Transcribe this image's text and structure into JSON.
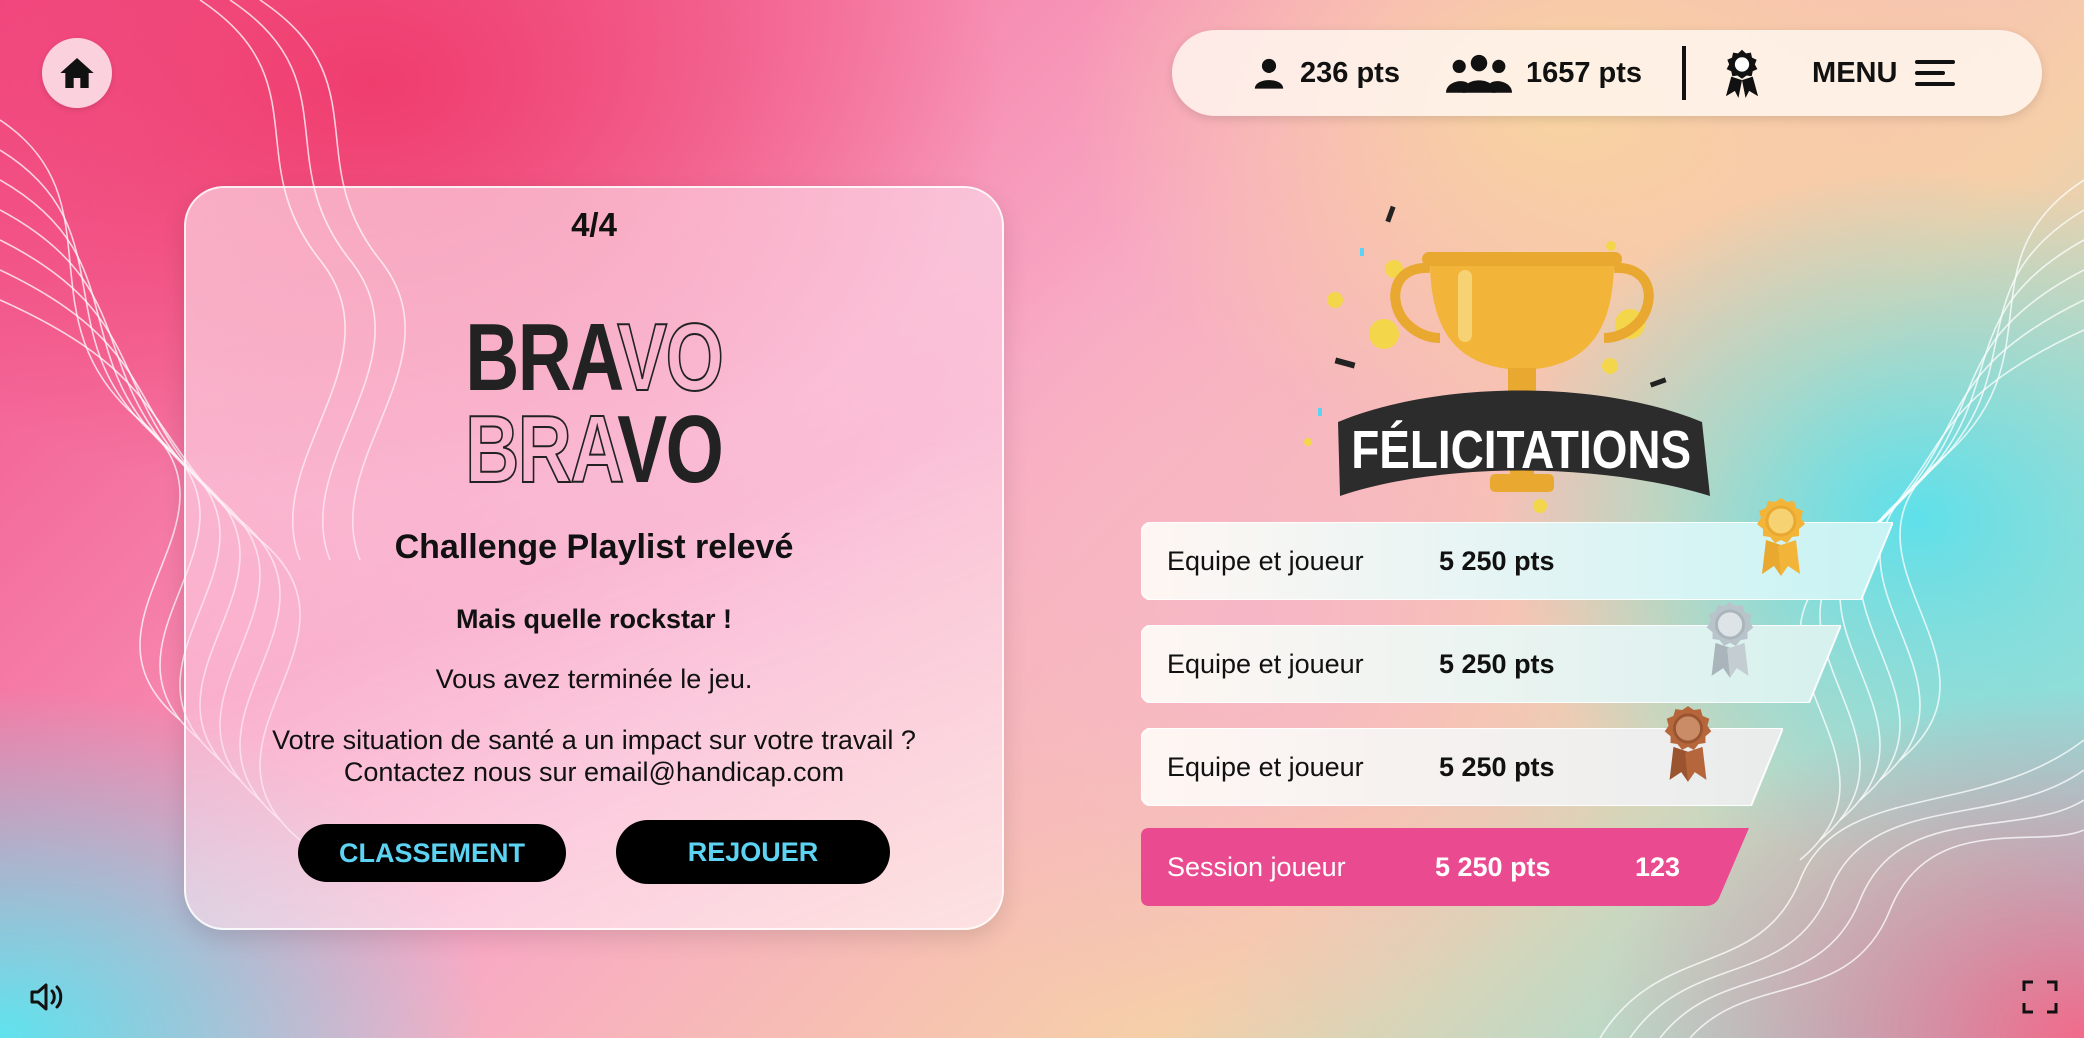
{
  "top_bar": {
    "player_points": "236 pts",
    "team_points": "1657 pts",
    "menu_label": "MENU"
  },
  "card": {
    "step": "4/4",
    "logo_lines": [
      "BRAVO",
      "BRAVO"
    ],
    "title": "Challenge Playlist relevé",
    "subtitle": "Mais quelle rockstar !",
    "text": "Vous avez terminée le jeu.",
    "info_line1": "Votre situation de santé a un impact sur votre travail ?",
    "info_line2": "Contactez nous sur email@handicap.com",
    "button_ranking": "CLASSEMENT",
    "button_replay": "REJOUER"
  },
  "congrats_banner": "FÉLICITATIONS",
  "ranking": [
    {
      "label": "Equipe et joueur",
      "points": "5 250 pts",
      "medal": "gold-medal-icon"
    },
    {
      "label": "Equipe et joueur",
      "points": "5 250 pts",
      "medal": "silver-medal-icon"
    },
    {
      "label": "Equipe et joueur",
      "points": "5 250 pts",
      "medal": "bronze-medal-icon"
    }
  ],
  "session": {
    "label": "Session joueur",
    "points": "5 250 pts",
    "rank": "123"
  },
  "colors": {
    "accent_pink": "#ea4a8f",
    "button_text_cyan": "#5cd3f2",
    "gold": "#f2b53a",
    "silver": "#b9c3ca",
    "bronze": "#b5673b"
  }
}
